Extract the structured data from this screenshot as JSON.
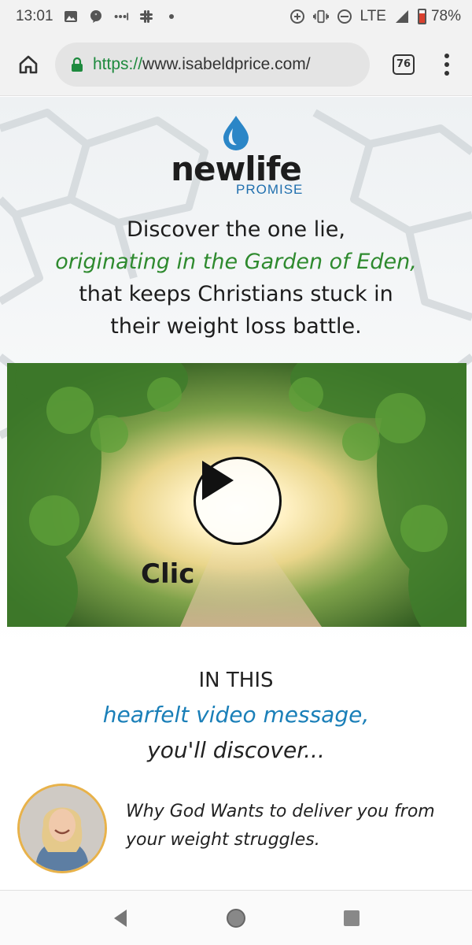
{
  "status_bar": {
    "time": "13:01",
    "network": "LTE",
    "battery_percent": "78%",
    "battery_level": 0.78,
    "icons": [
      "photo-icon",
      "chat-icon",
      "dots-icon",
      "slack-icon",
      "dot-icon",
      "data-saver-icon",
      "vibrate-icon",
      "dnd-icon",
      "signal-icon",
      "battery-icon"
    ]
  },
  "browser": {
    "url_scheme": "https://",
    "url_host": "www.isabeldprice.com/",
    "tab_count": "76",
    "icons": [
      "home-icon",
      "lock-icon",
      "menu-icon"
    ]
  },
  "logo": {
    "word": "newlife",
    "sub": "PROMISE"
  },
  "headline": {
    "line1": "Discover the one lie,",
    "line2": "originating in the Garden of Eden,",
    "line3": "that keeps Christians stuck in",
    "line4": "their weight loss battle."
  },
  "video": {
    "caption": "Clic",
    "icon": "play-icon"
  },
  "section": {
    "line1": "IN THIS",
    "line2": "hearfelt video message,",
    "line3": "you'll discover..."
  },
  "feature": {
    "text": "Why God Wants to deliver you from your weight struggles."
  },
  "nav": {
    "icons": [
      "back-icon",
      "home-circle-icon",
      "recents-icon"
    ]
  },
  "colors": {
    "green_text": "#2e8a2e",
    "blue_text": "#1a7fb8",
    "url_green": "#1e8a3e",
    "logo_blue": "#1f6fae",
    "avatar_ring": "#e8b24a"
  }
}
